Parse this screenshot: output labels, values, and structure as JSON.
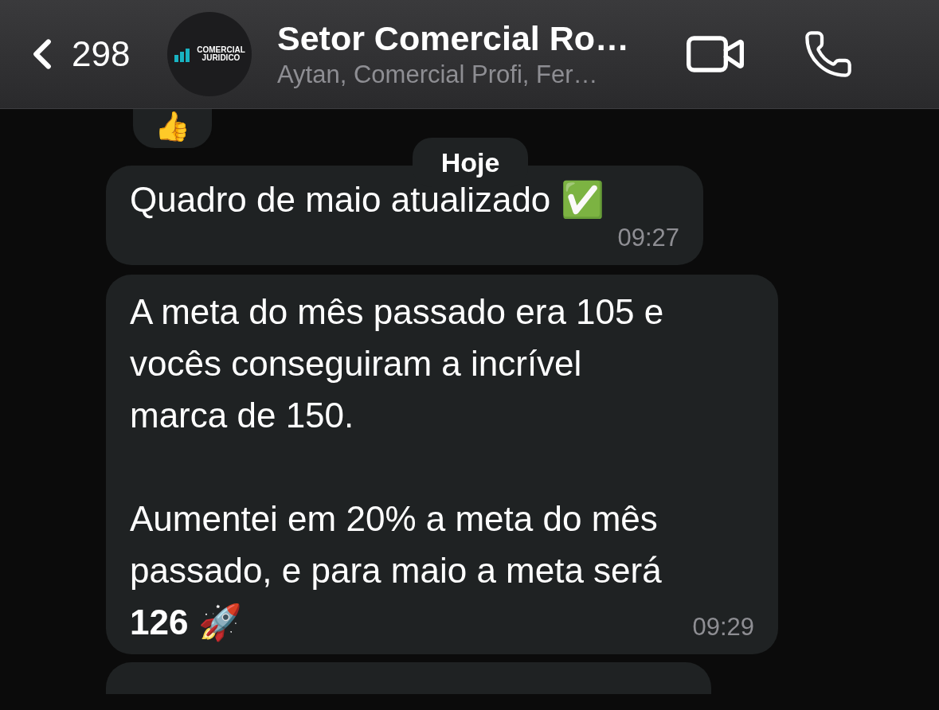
{
  "header": {
    "back_count": "298",
    "avatar_logo": [
      "COMERCIAL",
      "JURIDICO"
    ],
    "title": "Setor Comercial Ro…",
    "subtitle": "Aytan, Comercial Profi, Fer…"
  },
  "reaction": "👍",
  "date_chip": "Hoje",
  "messages": [
    {
      "text": "Quadro de maio atualizado ✅",
      "time": "09:27"
    },
    {
      "text": "A meta do mês passado era 105 e\nvocês conseguiram a incrível\nmarca de 150.\n\nAumentei em 20% a meta do mês\npassado, e para maio a meta será\n**126** 🚀",
      "time": "09:29"
    }
  ]
}
